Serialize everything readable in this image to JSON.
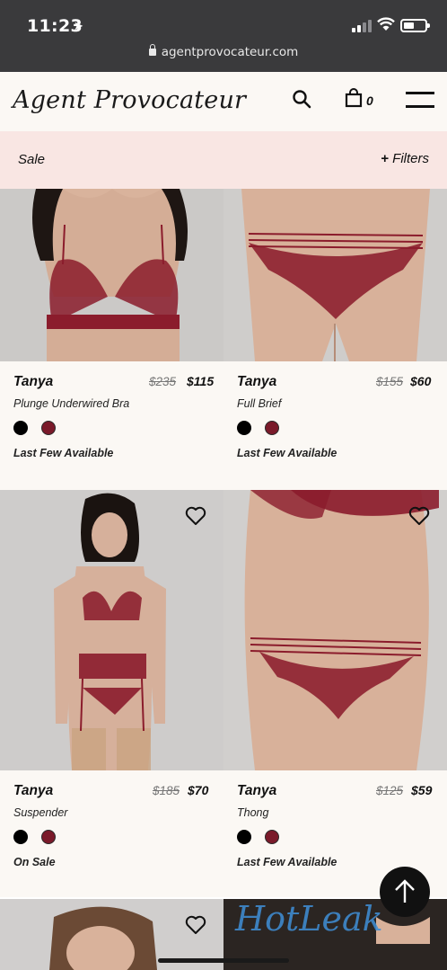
{
  "status": {
    "time": "11:23",
    "url": "agentprovocateur.com"
  },
  "header": {
    "logo": "Agent Provocateur",
    "bag_count": "0"
  },
  "salebar": {
    "label": "Sale",
    "filters_label": "Filters"
  },
  "products": [
    {
      "name": "Tanya",
      "old_price": "$235",
      "price": "$115",
      "desc": "Plunge Underwired Bra",
      "status": "Last Few Available"
    },
    {
      "name": "Tanya",
      "old_price": "$155",
      "price": "$60",
      "desc": "Full Brief",
      "status": "Last Few Available"
    },
    {
      "name": "Tanya",
      "old_price": "$185",
      "price": "$70",
      "desc": "Suspender",
      "status": "On Sale"
    },
    {
      "name": "Tanya",
      "old_price": "$125",
      "price": "$59",
      "desc": "Thong",
      "status": "Last Few Available"
    }
  ],
  "swatches": [
    "#000000",
    "#7a1a2a"
  ],
  "colors": {
    "accent_bg": "#f9e6e3",
    "card_bg": "#fbf8f4",
    "garment": "#8b1c2c"
  },
  "watermark": "HotLeak"
}
